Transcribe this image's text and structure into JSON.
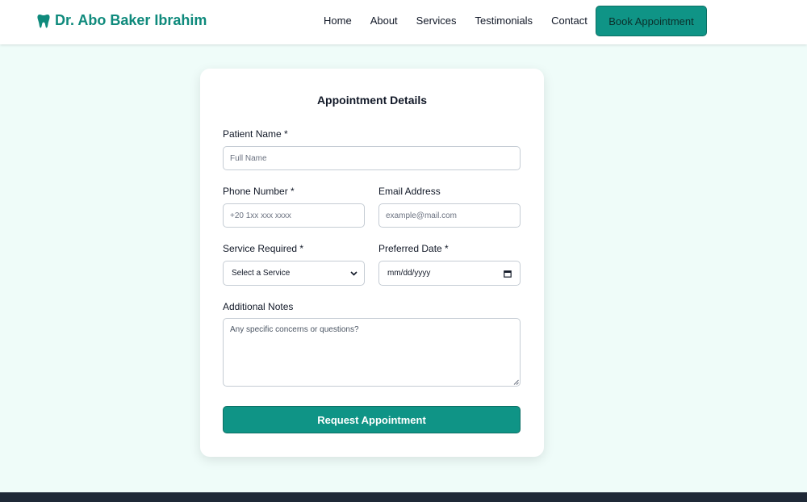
{
  "header": {
    "brand": "Dr. Abo Baker Ibrahim",
    "brand_icon": "tooth-icon",
    "nav": [
      "Home",
      "About",
      "Services",
      "Testimonials",
      "Contact"
    ],
    "cta": "Book Appointment"
  },
  "form": {
    "title": "Appointment Details",
    "patient_name": {
      "label": "Patient Name *",
      "placeholder": "Full Name"
    },
    "phone": {
      "label": "Phone Number *",
      "placeholder": "+20 1xx xxx xxxx"
    },
    "email": {
      "label": "Email Address",
      "placeholder": "example@mail.com"
    },
    "service": {
      "label": "Service Required *",
      "selected": "Select a Service"
    },
    "date": {
      "label": "Preferred Date *",
      "value": "mm/dd/yyyy"
    },
    "notes": {
      "label": "Additional Notes",
      "placeholder": "Any specific concerns or questions?"
    },
    "submit": "Request Appointment"
  },
  "colors": {
    "accent": "#0f9486",
    "brand_text": "#0f8a7c",
    "page_bg": "#effcf9",
    "footer": "#1f2937"
  }
}
